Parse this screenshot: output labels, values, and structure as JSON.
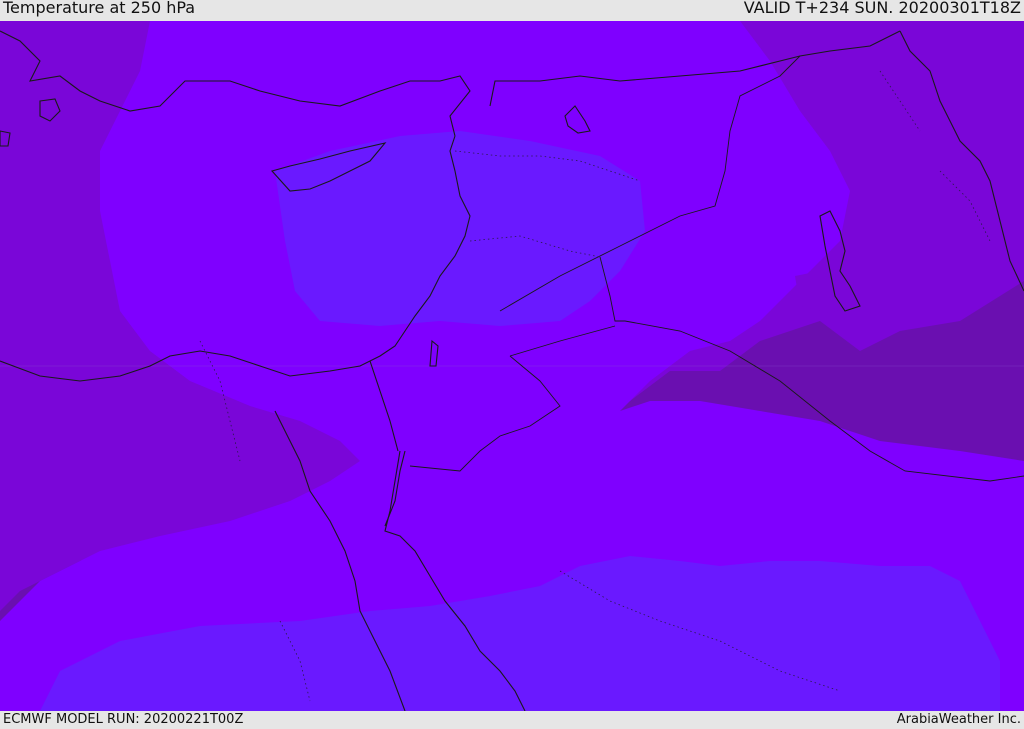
{
  "header": {
    "title": "Temperature at 250 hPa",
    "valid": "VALID T+234 SUN. 20200301T18Z"
  },
  "footer": {
    "model_run": "ECMWF MODEL RUN: 20200221T00Z",
    "credit": "ArabiaWeather Inc."
  },
  "colors": {
    "band_warm": "#6a0fb0",
    "band_mid": "#7a06d8",
    "band_bright": "#7f00ff",
    "band_cool": "#6a19ff",
    "coast": "#1a1a1a"
  }
}
